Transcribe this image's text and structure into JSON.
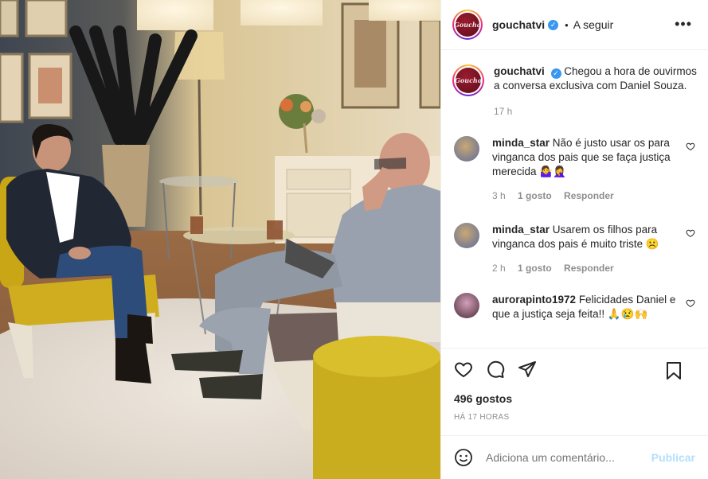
{
  "post": {
    "username": "gouchatvi",
    "follow_label": "A seguir",
    "more_label": "•••",
    "avatar_text": "Goucha"
  },
  "caption": {
    "username": "gouchatvi",
    "text": "Chegou a hora de ouvirmos a conversa exclusiva com Daniel Souza.",
    "time": "17 h"
  },
  "comments": [
    {
      "username": "minda_star",
      "text": "Não é justo usar os para vinganca dos pais que se faça justiça merecida 🤷‍♀️🤦‍♀️",
      "time": "3 h",
      "likes": "1 gosto",
      "reply": "Responder"
    },
    {
      "username": "minda_star",
      "text": "Usarem os filhos para vinganca dos pais é muito triste ☹️",
      "time": "2 h",
      "likes": "1 gosto",
      "reply": "Responder"
    },
    {
      "username": "aurorapinto1972",
      "text": "Felicidades Daniel e que a justiça seja feita!! 🙏😢🙌"
    }
  ],
  "stats": {
    "likes": "496 gostos",
    "ago": "HÁ 17 HORAS"
  },
  "composer": {
    "placeholder": "Adiciona um comentário...",
    "publish": "Publicar"
  },
  "icons": [
    "like-icon",
    "comment-icon",
    "share-icon",
    "save-icon",
    "emoji-icon",
    "more-icon",
    "verified-icon"
  ],
  "colors": {
    "text": "#262626",
    "muted": "#8e8e8e",
    "verified": "#3897f0",
    "publish_disabled": "#b2dffc",
    "border": "#efefef"
  }
}
